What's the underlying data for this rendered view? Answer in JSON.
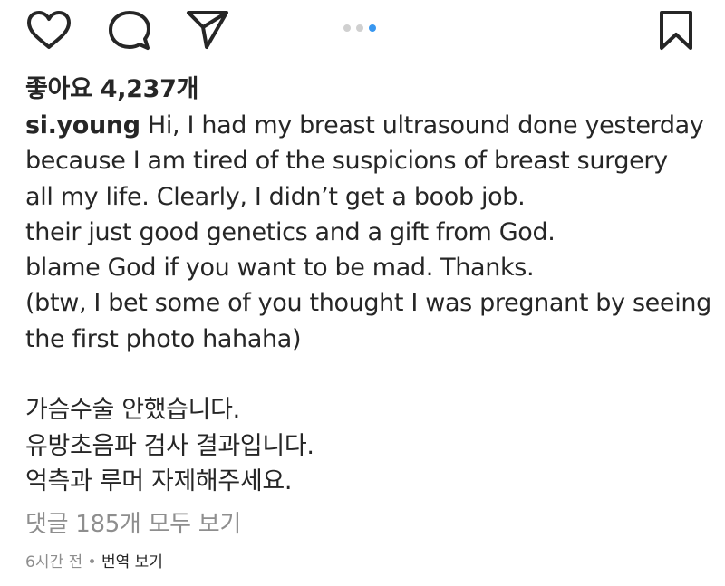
{
  "actions": {
    "like_icon": "heart-outline",
    "comment_icon": "speech-bubble-outline",
    "share_icon": "paper-plane-outline",
    "save_icon": "bookmark-outline"
  },
  "carousel": {
    "count": 3,
    "active_index": 2,
    "active_color": "#3897f0",
    "inactive_color": "#d0d0d0"
  },
  "likes_label": "좋아요 4,237개",
  "post": {
    "username": "si.young",
    "caption_first_line": " Hi, I had my breast ultrasound done yesterday",
    "caption_lines": [
      "because I am tired of the suspicions of breast surgery",
      "all my life. Clearly, I didn’t get a boob job.",
      "their just good genetics and a gift from God.",
      "blame God if you want to be mad. Thanks.",
      "(btw, I bet some of you thought I was pregnant by seeing",
      "the first photo hahaha)"
    ],
    "korean_lines": [
      "가슴수술 안했습니다.",
      "유방초음파 검사 결과입니다.",
      "억측과 루머 자제해주세요."
    ]
  },
  "view_comments_label": "댓글 185개 모두 보기",
  "meta": {
    "time_ago": "6시간 전",
    "separator": " • ",
    "translate_label": "번역 보기"
  }
}
